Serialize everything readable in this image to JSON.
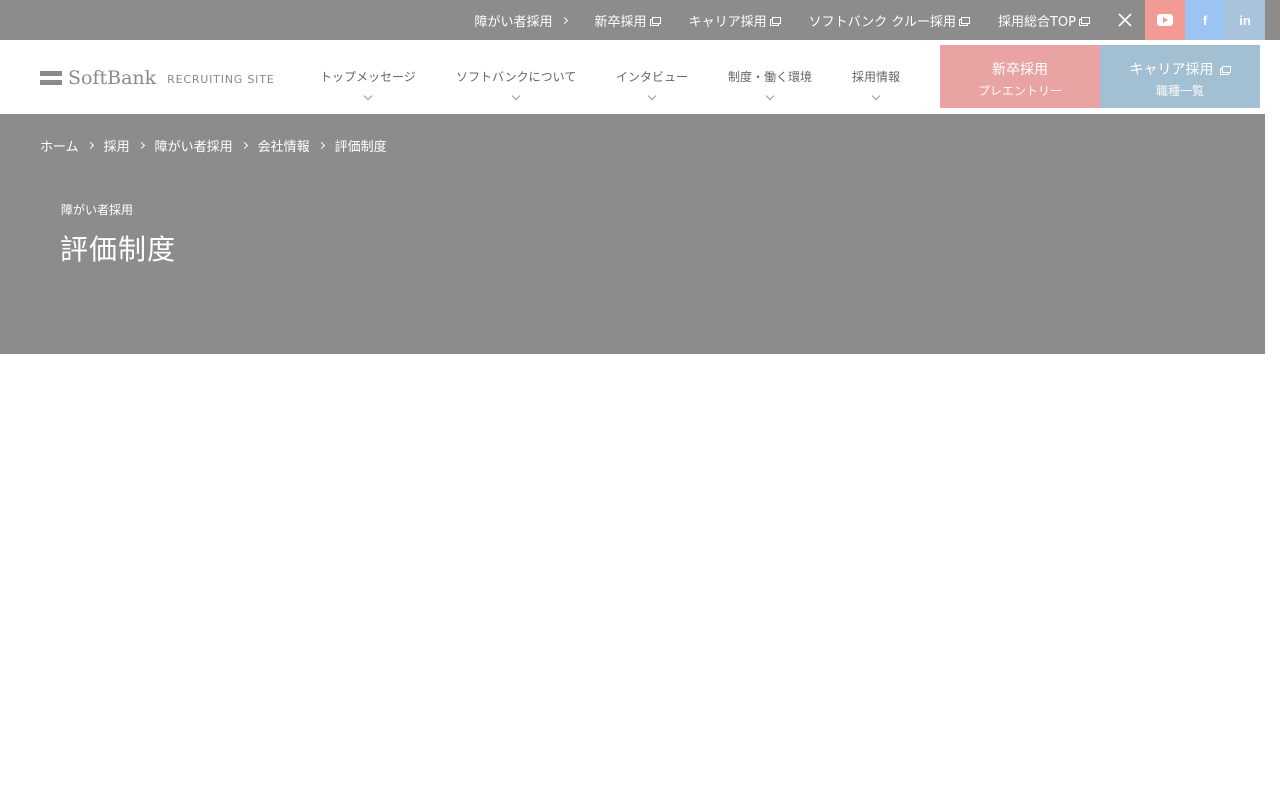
{
  "utility": {
    "links": [
      {
        "label": "障がい者採用",
        "icon": "chevron-right-icon"
      },
      {
        "label": "新卒採用",
        "icon": "external-link-icon"
      },
      {
        "label": "キャリア採用",
        "icon": "external-link-icon"
      },
      {
        "label": "ソフトバンク クルー採用",
        "icon": "external-link-icon"
      },
      {
        "label": "採用総合TOP",
        "icon": "external-link-icon"
      }
    ],
    "social": [
      {
        "name": "x",
        "icon": "x-icon",
        "color": "#8c8c8c"
      },
      {
        "name": "youtube",
        "icon": "youtube-icon",
        "color": "#f49a95"
      },
      {
        "name": "facebook",
        "icon": "facebook-icon",
        "glyph": "f",
        "color": "#9cc4f2"
      },
      {
        "name": "linkedin",
        "icon": "linkedin-icon",
        "glyph": "in",
        "color": "#a9c3dd"
      }
    ]
  },
  "header": {
    "logo_text": "SoftBank",
    "logo_sub": "RECRUITING SITE",
    "nav": [
      {
        "label": "トップメッセージ"
      },
      {
        "label": "ソフトバンクについて"
      },
      {
        "label": "インタビュー"
      },
      {
        "label": "制度・働く環境"
      },
      {
        "label": "採用情報"
      }
    ],
    "cta_newgrad": {
      "title": "新卒採用",
      "sub": "プレエントリー",
      "color": "#e9a3a3"
    },
    "cta_career": {
      "title": "キャリア採用",
      "sub": "職種一覧",
      "color": "#a3bfd2"
    }
  },
  "breadcrumb": [
    "ホーム",
    "採用",
    "障がい者採用",
    "会社情報",
    "評価制度"
  ],
  "hero": {
    "eyebrow": "障がい者採用",
    "title": "評価制度",
    "background": "#8c8c8c"
  }
}
